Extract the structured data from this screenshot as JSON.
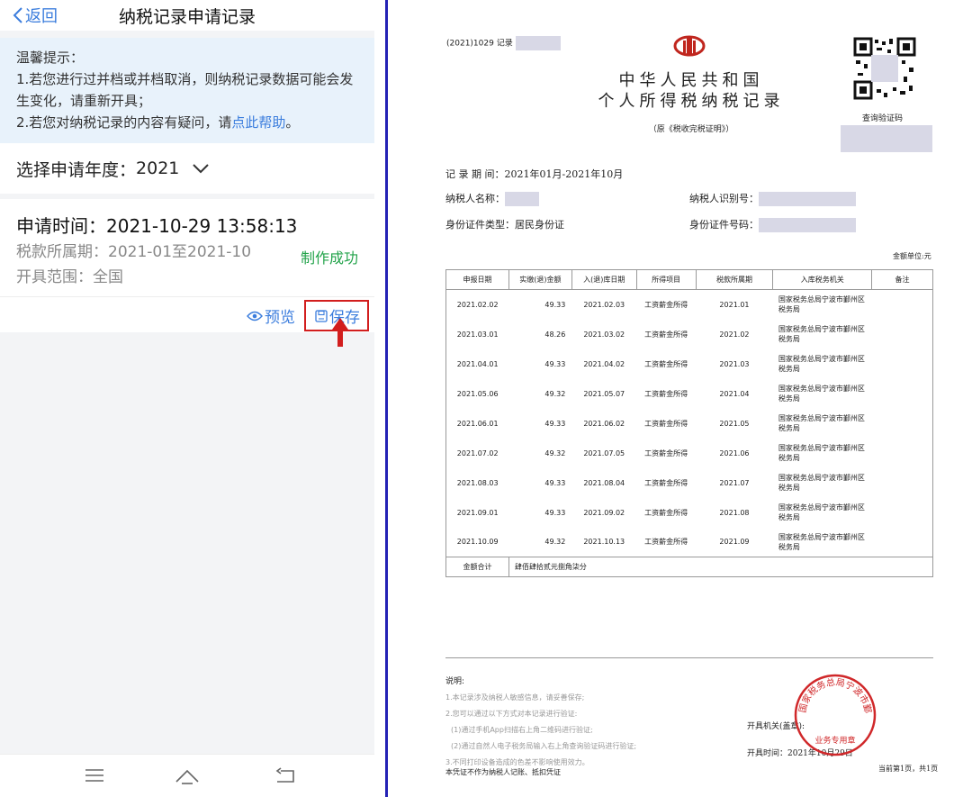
{
  "phone": {
    "back_label": "返回",
    "title": "纳税记录申请记录",
    "tip_heading": "温馨提示：",
    "tip_line1": "1.若您进行过并档或并档取消，则纳税记录数据可能会发生变化，请重新开具；",
    "tip_line2_prefix": "2.若您对纳税记录的内容有疑问，请",
    "tip_link": "点此帮助",
    "tip_line2_suffix": "。",
    "year_label": "选择申请年度：",
    "year_value": "2021",
    "apply_time": "申请时间：2021-10-29 13:58:13",
    "period": "税款所属期：2021-01至2021-10",
    "scope": "开具范围：全国",
    "status": "制作成功",
    "preview_label": "预览",
    "save_label": "保存"
  },
  "document": {
    "doc_no": "(2021)1029 记录",
    "title_line1": "中华人民共和国",
    "title_line2": "个人所得税纳税记录",
    "subtitle": "（原《税收完税证明》）",
    "qr_label": "查询验证码",
    "period_label": "记 录 期 间：",
    "period_value": "2021年01月-2021年10月",
    "name_label": "纳税人名称：",
    "tin_label": "纳税人识别号：",
    "id_type_label": "身份证件类型：",
    "id_type_value": "居民身份证",
    "id_no_label": "身份证件号码：",
    "unit": "金额单位:元",
    "columns": [
      "申报日期",
      "实缴(退)金额",
      "入(退)库日期",
      "所得项目",
      "税款所属期",
      "入库税务机关",
      "备注"
    ],
    "rows": [
      [
        "2021.02.02",
        "49.33",
        "2021.02.03",
        "工资薪金所得",
        "2021.01",
        "国家税务总局宁波市鄞州区税务局",
        ""
      ],
      [
        "2021.03.01",
        "48.26",
        "2021.03.02",
        "工资薪金所得",
        "2021.02",
        "国家税务总局宁波市鄞州区税务局",
        ""
      ],
      [
        "2021.04.01",
        "49.33",
        "2021.04.02",
        "工资薪金所得",
        "2021.03",
        "国家税务总局宁波市鄞州区税务局",
        ""
      ],
      [
        "2021.05.06",
        "49.32",
        "2021.05.07",
        "工资薪金所得",
        "2021.04",
        "国家税务总局宁波市鄞州区税务局",
        ""
      ],
      [
        "2021.06.01",
        "49.33",
        "2021.06.02",
        "工资薪金所得",
        "2021.05",
        "国家税务总局宁波市鄞州区税务局",
        ""
      ],
      [
        "2021.07.02",
        "49.32",
        "2021.07.05",
        "工资薪金所得",
        "2021.06",
        "国家税务总局宁波市鄞州区税务局",
        ""
      ],
      [
        "2021.08.03",
        "49.33",
        "2021.08.04",
        "工资薪金所得",
        "2021.07",
        "国家税务总局宁波市鄞州区税务局",
        ""
      ],
      [
        "2021.09.01",
        "49.33",
        "2021.09.02",
        "工资薪金所得",
        "2021.08",
        "国家税务总局宁波市鄞州区税务局",
        ""
      ],
      [
        "2021.10.09",
        "49.32",
        "2021.10.13",
        "工资薪金所得",
        "2021.09",
        "国家税务总局宁波市鄞州区税务局",
        ""
      ]
    ],
    "total_label": "金额合计",
    "total_value": "肆佰肆拾贰元捌角柒分",
    "notes_heading": "说明:",
    "notes": [
      "1.本记录涉及纳税人敏感信息，请妥善保存;",
      "2.您可以通过以下方式对本记录进行验证:",
      "(1)通过手机App扫描右上角二维码进行验证;",
      "(2)通过自然人电子税务局输入右上角查询验证码进行验证;",
      "3.不同打印设备造成的色差不影响使用效力。"
    ],
    "footer_note": "本凭证不作为纳税人记账、抵扣凭证",
    "issuer_label": "开具机关(盖章):",
    "issue_time": "开具时间：2021年10月29日",
    "page_info": "当前第1页，共1页",
    "stamp_outer": "国家税务总局宁波市鄞州区税务局",
    "stamp_inner": "业务专用章"
  }
}
